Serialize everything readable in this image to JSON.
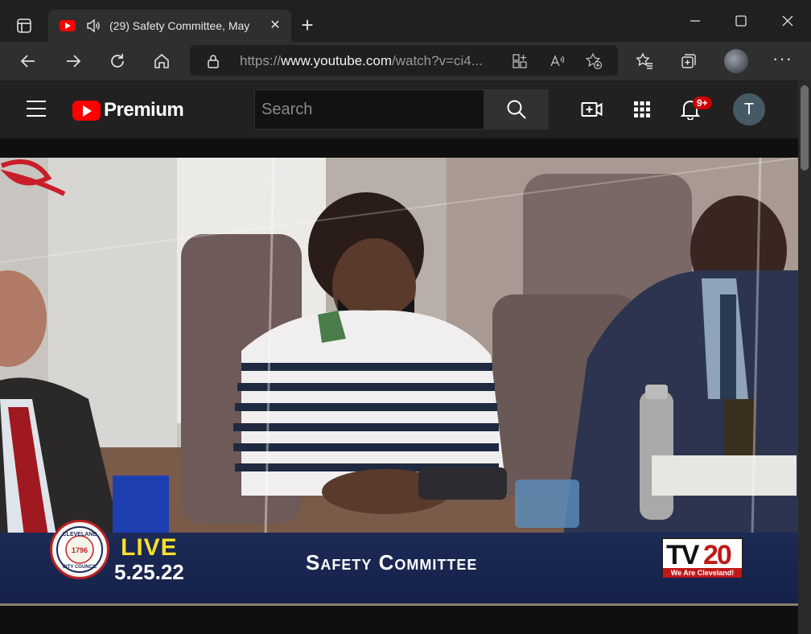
{
  "browser": {
    "tab_title": "(29) Safety Committee, May",
    "tab_close": "✕",
    "new_tab": "+",
    "url_prefix": "https://",
    "url_host": "www.youtube.com",
    "url_path": "/watch?v=ci4...",
    "more": "···"
  },
  "youtube": {
    "logo_text": "Premium",
    "search_placeholder": "Search",
    "notification_badge": "9+",
    "avatar_letter": "T"
  },
  "video": {
    "live_label": "LIVE",
    "date": "5.25.22",
    "program_title": "Safety Committee",
    "channel_tv": "TV",
    "channel_num": "20",
    "channel_tagline": "We Are Cleveland!",
    "seal_text_top": "CLEVELAND",
    "seal_year": "1796",
    "seal_text_bottom": "CITY COUNCIL"
  }
}
